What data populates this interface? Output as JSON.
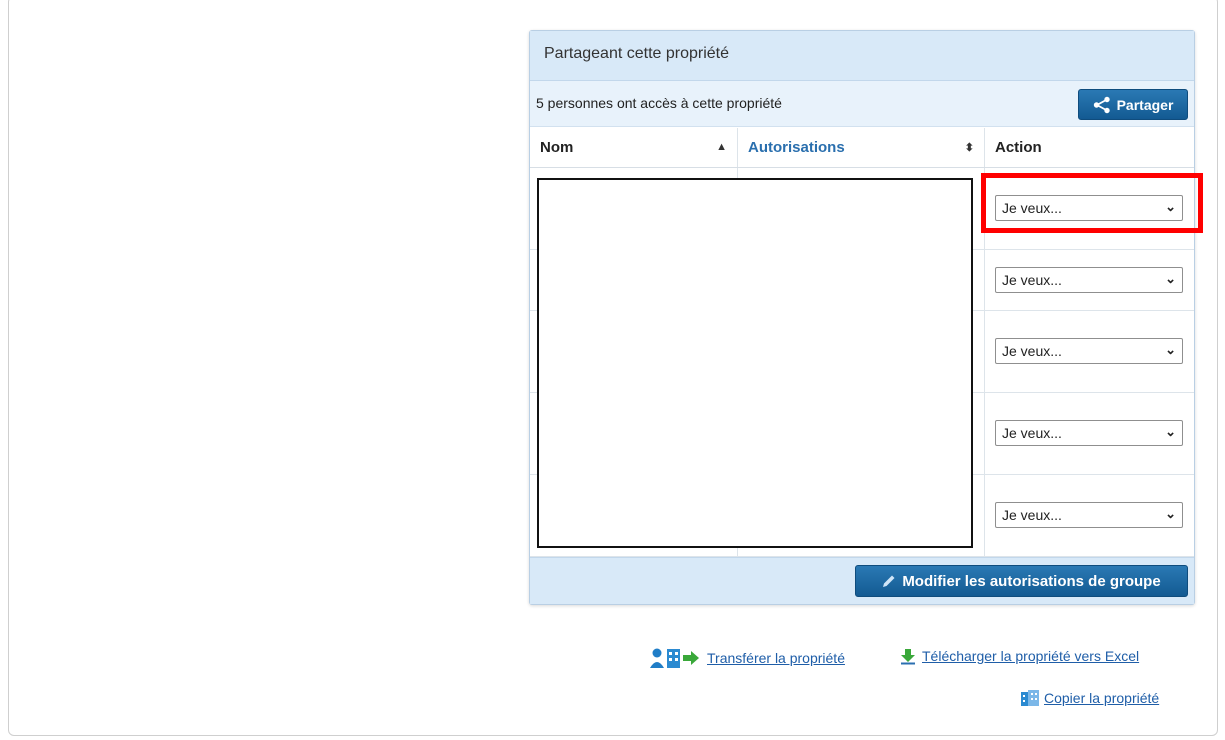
{
  "panel": {
    "title": "Partageant cette propriété",
    "access_text": "5 personnes ont accès à cette propriété",
    "share_label": "Partager"
  },
  "table": {
    "headers": {
      "name": "Nom",
      "permissions": "Autorisations",
      "action": "Action"
    },
    "rows": [
      {
        "action": "Je veux..."
      },
      {
        "action": "Je veux..."
      },
      {
        "action": "Je veux..."
      },
      {
        "action": "Je veux..."
      },
      {
        "action": "Je veux..."
      }
    ]
  },
  "footer": {
    "group_permissions_label": "Modifier les autorisations de groupe"
  },
  "links": {
    "transfer": "Transférer la propriété",
    "download_excel": "Télécharger la propriété vers Excel",
    "copy": "Copier la propriété"
  },
  "colors": {
    "accent": "#1f5ea8",
    "header_bg": "#d8e9f8",
    "highlight": "#ff0000"
  },
  "icons": [
    "share-icon",
    "pencil-icon",
    "transfer-icon",
    "download-icon",
    "copy-icon",
    "chevron-down-icon",
    "sort-asc-icon",
    "sort-both-icon"
  ]
}
